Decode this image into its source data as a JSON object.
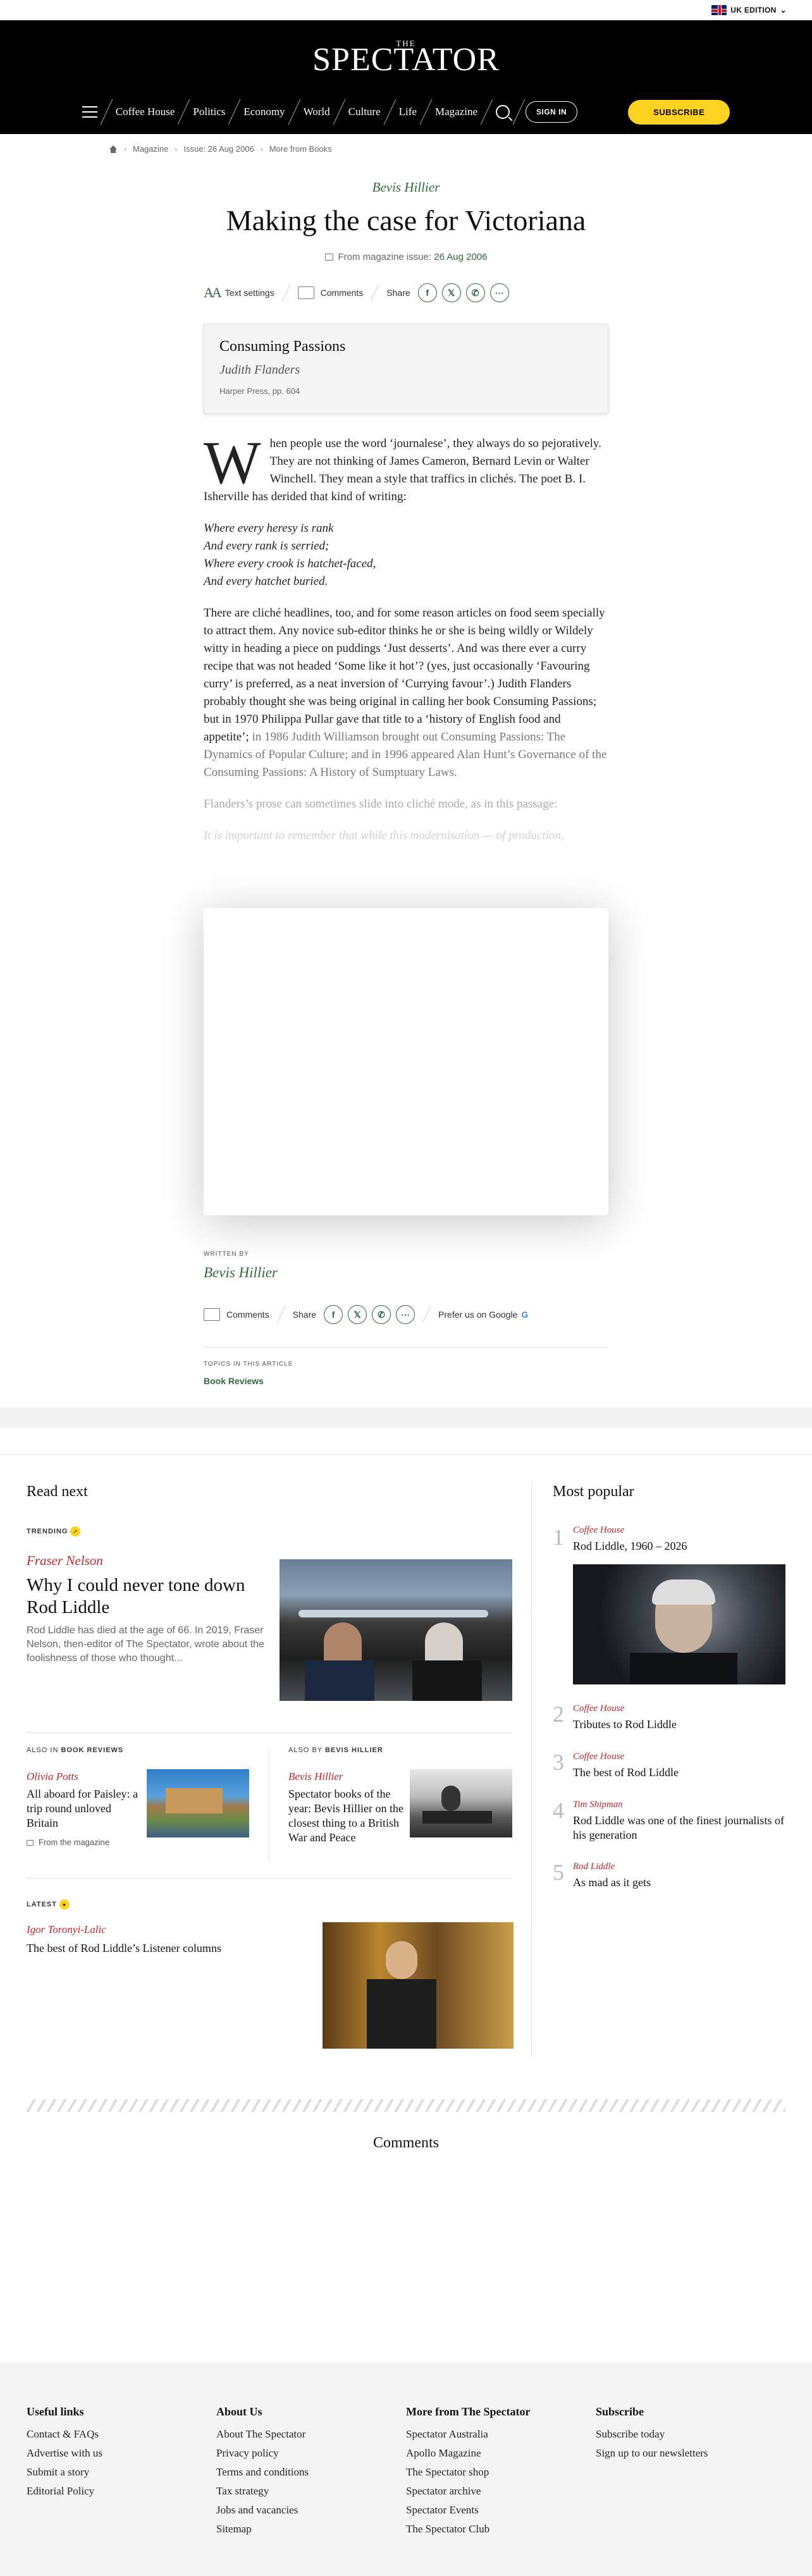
{
  "edition": {
    "label": "UK EDITION"
  },
  "header": {
    "logo_the": "THE",
    "logo": "SPECTATOR",
    "nav": [
      "Coffee House",
      "Politics",
      "Economy",
      "World",
      "Culture",
      "Life",
      "Magazine"
    ],
    "sign_in": "SIGN IN",
    "subscribe": "SUBSCRIBE"
  },
  "breadcrumb": [
    "Magazine",
    "Issue: 26 Aug 2006",
    "More from Books"
  ],
  "article": {
    "author": "Bevis Hillier",
    "title": "Making the case for Victoriana",
    "issue_prefix": "From magazine issue:",
    "issue_date": "26 Aug 2006",
    "toolbar": {
      "text_settings": "Text settings",
      "comments": "Comments",
      "share": "Share",
      "prefer_google": "Prefer us on Google"
    },
    "book": {
      "title": "Consuming Passions",
      "author": "Judith Flanders",
      "publisher": "Harper Press, pp. 604"
    },
    "dropcap": "W",
    "p1": "hen people use the word ‘journalese’, they always do so pejoratively. They are not thinking of James Cameron, Bernard Levin or Walter Winchell. They mean a style that traffics in clichés. The poet B. I. Isherville has derided that kind of writing:",
    "poem": [
      "Where every heresy is rank",
      "And every rank is serried;",
      "Where every crook is hatchet-faced,",
      "And every hatchet buried."
    ],
    "p2_a": "There are cliché headlines, too, and for some reason articles on food seem specially to attract them. Any novice sub-editor thinks he or she is being wildly or Wildely witty in heading a piece on puddings ‘Just desserts’. And was there ever a curry recipe that was not headed ‘Some like it hot’? (yes, just occasionally ‘Favouring curry’ is preferred, as a neat inversion of ‘Currying favour’.) Judith Flanders probably thought she was being original in calling her book Consuming Passions; but in 1970 Philippa Pullar gave that title to a ‘history of English food and appetite’;",
    "p2_b": "in 1986 Judith Williamson brought out Consuming Passions: The Dynamics of Popular Culture; and in 1996 appeared Alan Hunt’s Governance of the Consuming Passions: A History of Sumptuary Laws.",
    "p3": "Flanders’s prose can sometimes slide into cliché mode, as in this passage:",
    "p4": "It is important to remember that while this modernisation — of production,"
  },
  "written_by": {
    "label": "WRITTEN BY",
    "name": "Bevis Hillier"
  },
  "topics": {
    "label": "TOPICS IN THIS ARTICLE",
    "value": "Book Reviews"
  },
  "read_next": {
    "title": "Read next",
    "trending": {
      "kicker": "TRENDING",
      "author": "Fraser Nelson",
      "headline": "Why I could never tone down Rod Liddle",
      "excerpt": "Rod Liddle has died at the age of 66. In 2019, Fraser Nelson, then-editor of The Spectator, wrote about the foolishness of those who thought..."
    },
    "also_in": {
      "kicker_prefix": "ALSO IN",
      "kicker_value": "BOOK REVIEWS",
      "author": "Olivia Potts",
      "headline": "All aboard for Paisley: a trip round unloved Britain",
      "meta": "From the magazine"
    },
    "also_by": {
      "kicker_prefix": "ALSO BY",
      "kicker_value": "BEVIS HILLIER",
      "author": "Bevis Hillier",
      "headline": "Spectator books of the year: Bevis Hillier on the closest thing to a British War and Peace"
    },
    "latest": {
      "kicker": "LATEST",
      "author": "Igor Toronyi-Lalic",
      "headline": "The best of Rod Liddle’s Listener columns"
    }
  },
  "most_popular": {
    "title": "Most popular",
    "items": [
      {
        "num": "1",
        "cat": "Coffee House",
        "headline": "Rod Liddle, 1960 – 2026"
      },
      {
        "num": "2",
        "cat": "Coffee House",
        "headline": "Tributes to Rod Liddle"
      },
      {
        "num": "3",
        "cat": "Coffee House",
        "headline": "The best of Rod Liddle"
      },
      {
        "num": "4",
        "cat": "Tim Shipman",
        "headline": "Rod Liddle was one of the finest journalists of his generation"
      },
      {
        "num": "5",
        "cat": "Rod Liddle",
        "headline": "As mad as it gets"
      }
    ]
  },
  "comments": {
    "title": "Comments"
  },
  "footer": {
    "cols": [
      {
        "title": "Useful links",
        "items": [
          "Contact & FAQs",
          "Advertise with us",
          "Submit a story",
          "Editorial Policy"
        ]
      },
      {
        "title": "About Us",
        "items": [
          "About The Spectator",
          "Privacy policy",
          "Terms and conditions",
          "Tax strategy",
          "Jobs and vacancies",
          "Sitemap"
        ]
      },
      {
        "title": "More from The Spectator",
        "items": [
          "Spectator Australia",
          "Apollo Magazine",
          "The Spectator shop",
          "Spectator archive",
          "Spectator Events",
          "The Spectator Club"
        ]
      },
      {
        "title": "Subscribe",
        "items": [
          "Subscribe today",
          "Sign up to our newsletters"
        ]
      }
    ]
  }
}
